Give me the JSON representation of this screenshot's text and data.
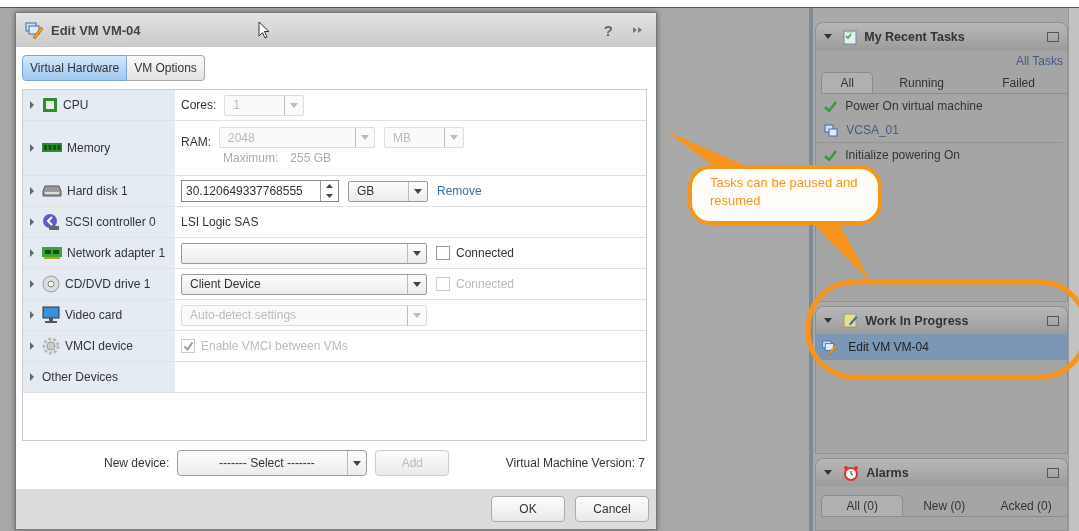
{
  "dialog": {
    "title": "Edit VM VM-04",
    "help": "?",
    "tabs": [
      {
        "label": "Virtual Hardware",
        "selected": true
      },
      {
        "label": "VM Options",
        "selected": false
      }
    ],
    "hardware": [
      {
        "label": "CPU",
        "expanded": false,
        "caption": "Cores:",
        "controls": [
          {
            "kind": "count",
            "value": "1",
            "disabled": true
          }
        ]
      },
      {
        "label": "Memory",
        "expanded": false,
        "caption": "RAM:",
        "controls": [
          {
            "kind": "amount",
            "value": "2048",
            "disabled": true
          },
          {
            "kind": "unit",
            "value": "MB",
            "disabled": true
          }
        ],
        "note": {
          "label": "Maximum:",
          "value": "255 GB",
          "disabled": true
        }
      },
      {
        "label": "Hard disk 1",
        "expanded": false,
        "controls": [
          {
            "kind": "spinner",
            "value": "30.120649337768555"
          },
          {
            "kind": "unit",
            "value": "GB",
            "disabled": false
          },
          {
            "kind": "link",
            "text": "Remove"
          }
        ]
      },
      {
        "label": "SCSI controller 0",
        "expanded": false,
        "controls": [
          {
            "kind": "text",
            "text": "LSI Logic SAS"
          }
        ]
      },
      {
        "label": "Network adapter 1",
        "expanded": false,
        "controls": [
          {
            "kind": "select",
            "disabled": false
          },
          {
            "kind": "checkbox",
            "text": "Connected",
            "checked": false,
            "disabled": false
          }
        ]
      },
      {
        "label": "CD/DVD drive 1",
        "expanded": false,
        "controls": [
          {
            "kind": "select",
            "value": "Client Device",
            "disabled": false
          },
          {
            "kind": "checkbox",
            "text": "Connected",
            "checked": false,
            "disabled": true
          }
        ]
      },
      {
        "label": "Video card",
        "expanded": false,
        "controls": [
          {
            "kind": "select",
            "value": "Auto-detect settings",
            "disabled": true
          }
        ]
      },
      {
        "label": "VMCI device",
        "expanded": false,
        "controls": [
          {
            "kind": "checkbox",
            "text": "Enable VMCI between VMs",
            "checked": true,
            "disabled": true
          }
        ]
      },
      {
        "label": "Other Devices",
        "expanded": false
      }
    ],
    "new_device": {
      "label": "New device:",
      "value": "------- Select -------",
      "add": "Add",
      "add_disabled": true
    },
    "version": "Virtual Machine Version: 7",
    "buttons": [
      "OK",
      "Cancel"
    ]
  },
  "recent_tasks": {
    "title": "My Recent Tasks",
    "all_tasks": "All Tasks",
    "tabs": [
      {
        "label": "All",
        "selected": true
      },
      {
        "label": "Running",
        "selected": false
      },
      {
        "label": "Failed",
        "selected": false
      }
    ],
    "tasks": [
      {
        "kind": "status",
        "text": "Power On virtual machine"
      },
      {
        "kind": "object",
        "text": "VCSA_01"
      },
      {
        "kind": "status",
        "text": "Initialize powering On"
      }
    ]
  },
  "work_in_progress": {
    "title": "Work In Progress",
    "items": [
      {
        "text": "Edit VM VM-04",
        "selected": true
      }
    ]
  },
  "alarms": {
    "title": "Alarms",
    "tabs": [
      {
        "label": "All (0)",
        "selected": true
      },
      {
        "label": "New (0)",
        "selected": false
      },
      {
        "label": "Acked (0)",
        "selected": false
      }
    ]
  },
  "callout": {
    "text": "Tasks can be paused and resumed"
  }
}
